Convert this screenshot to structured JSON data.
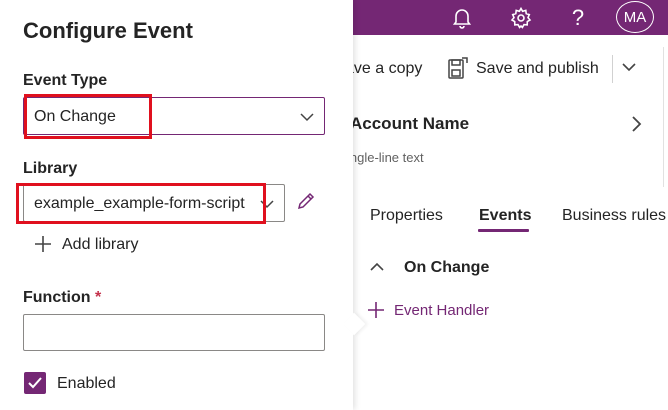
{
  "app_header": {
    "bg_color": "#742774",
    "icons": [
      "bell-icon",
      "gear-icon",
      "help-icon"
    ],
    "avatar_initials": "MA"
  },
  "toolbar": {
    "save_copy_label": "ave a copy",
    "save_publish_label": "Save and publish",
    "dropdown_icon": "chevron-down-icon"
  },
  "field": {
    "title": "Account Name",
    "subtitle": "ingle-line text"
  },
  "tabs": [
    {
      "label": "Properties",
      "selected": false
    },
    {
      "label": "Events",
      "selected": true
    },
    {
      "label": "Business rules",
      "selected": false
    }
  ],
  "events_section": {
    "title": "On Change",
    "add_handler_label": "Event Handler"
  },
  "panel": {
    "title": "Configure Event",
    "event_type": {
      "label": "Event Type",
      "value": "On Change"
    },
    "library": {
      "label": "Library",
      "value": "example_example-form-script",
      "add_label": "Add library"
    },
    "function": {
      "label": "Function",
      "required_mark": "*",
      "value": ""
    },
    "enabled": {
      "label": "Enabled",
      "checked": true
    }
  },
  "colors": {
    "accent": "#742774",
    "highlight": "#e0101e",
    "required": "#c4314b"
  }
}
